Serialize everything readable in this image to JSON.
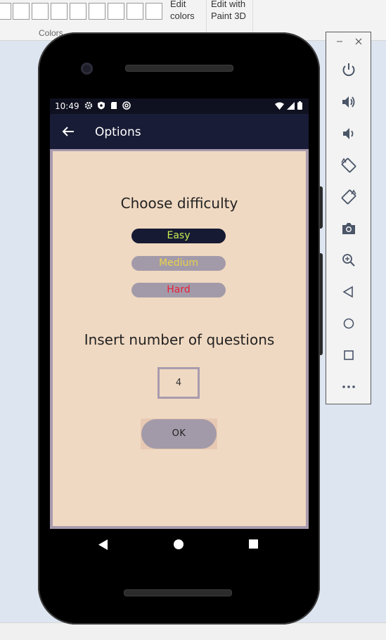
{
  "paint_ribbon": {
    "edit_colors_label": "Edit colors",
    "edit_paint3d_label": "Edit with Paint 3D",
    "colors_group_label": "Colors"
  },
  "status_bar": {
    "time": "10:49",
    "icons": [
      "gear-icon",
      "shield-icon",
      "sd-card-icon",
      "at-sign-icon",
      "wifi-icon",
      "signal-icon",
      "battery-icon"
    ]
  },
  "app_bar": {
    "title": "Options",
    "back_icon": "arrow-left-icon"
  },
  "options": {
    "difficulty_heading": "Choose difficulty",
    "difficulties": [
      {
        "label": "Easy",
        "selected": true,
        "text_color": "#c6ef52",
        "bg_color": "#161a33"
      },
      {
        "label": "Medium",
        "selected": false,
        "text_color": "#e8d24a",
        "bg_color": "#a39aa9"
      },
      {
        "label": "Hard",
        "selected": false,
        "text_color": "#e8223a",
        "bg_color": "#a39aa9"
      }
    ],
    "questions_heading": "Insert number of questions",
    "questions_value": "4",
    "ok_label": "OK"
  },
  "nav_bar": {
    "buttons": [
      "back-triangle-icon",
      "home-circle-icon",
      "recents-square-icon"
    ]
  },
  "emulator_toolbar": {
    "window_buttons": [
      "minimize-icon",
      "close-icon"
    ],
    "items": [
      "power-icon",
      "volume-up-icon",
      "volume-down-icon",
      "rotate-left-icon",
      "rotate-right-icon",
      "camera-icon",
      "zoom-icon",
      "back-icon",
      "home-icon",
      "overview-icon",
      "more-icon"
    ]
  },
  "colors": {
    "screen_bg": "#f0d9c2",
    "appbar_bg": "#181c36",
    "border_lilac": "#a99bae"
  }
}
